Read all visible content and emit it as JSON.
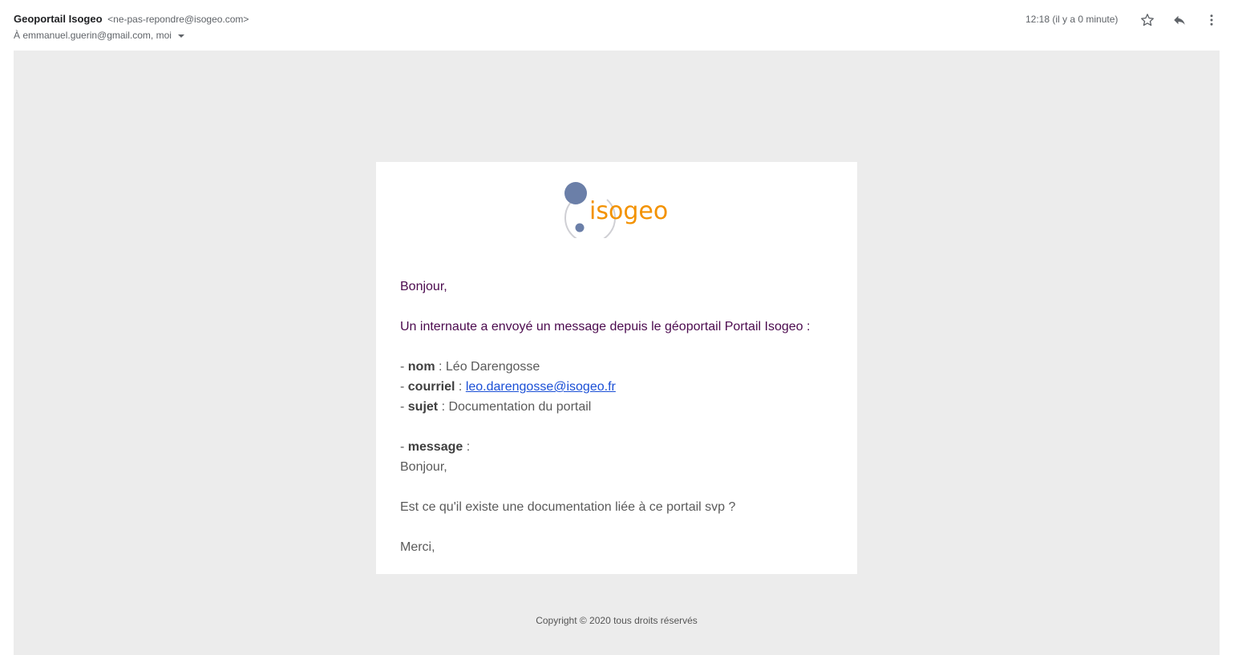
{
  "header": {
    "sender_name": "Geoportail Isogeo",
    "sender_email": "<ne-pas-repondre@isogeo.com>",
    "recipients": "À emmanuel.guerin@gmail.com, moi",
    "timestamp": "12:18 (il y a 0 minute)",
    "icons": [
      "star-icon",
      "reply-icon",
      "more-vertical-icon"
    ]
  },
  "email": {
    "logo_text": "isogeo",
    "greeting": "Bonjour,",
    "intro": "Un internaute a envoyé un message depuis le géoportail Portail Isogeo :",
    "dash": "- ",
    "fields": {
      "nom_label": "nom",
      "nom_sep": " : ",
      "nom_value": "Léo Darengosse",
      "courriel_label": "courriel",
      "courriel_sep": " : ",
      "courriel_value": "leo.darengosse@isogeo.fr",
      "sujet_label": "sujet",
      "sujet_sep": " : ",
      "sujet_value": "Documentation du portail",
      "message_label": "message",
      "message_sep": " :"
    },
    "message_lines": [
      "Bonjour,",
      "Est ce qu'il existe une documentation liée à ce portail svp ?",
      "Merci,"
    ]
  },
  "footer": {
    "copyright": "Copyright © 2020 tous droits réservés"
  },
  "colors": {
    "canvas_bg": "#ececec",
    "card_bg": "#ffffff",
    "logo_blue": "#6b7fa8",
    "logo_orange": "#f39200",
    "intro_purple": "#4b0a4e",
    "link_blue": "#1a4fd6"
  }
}
